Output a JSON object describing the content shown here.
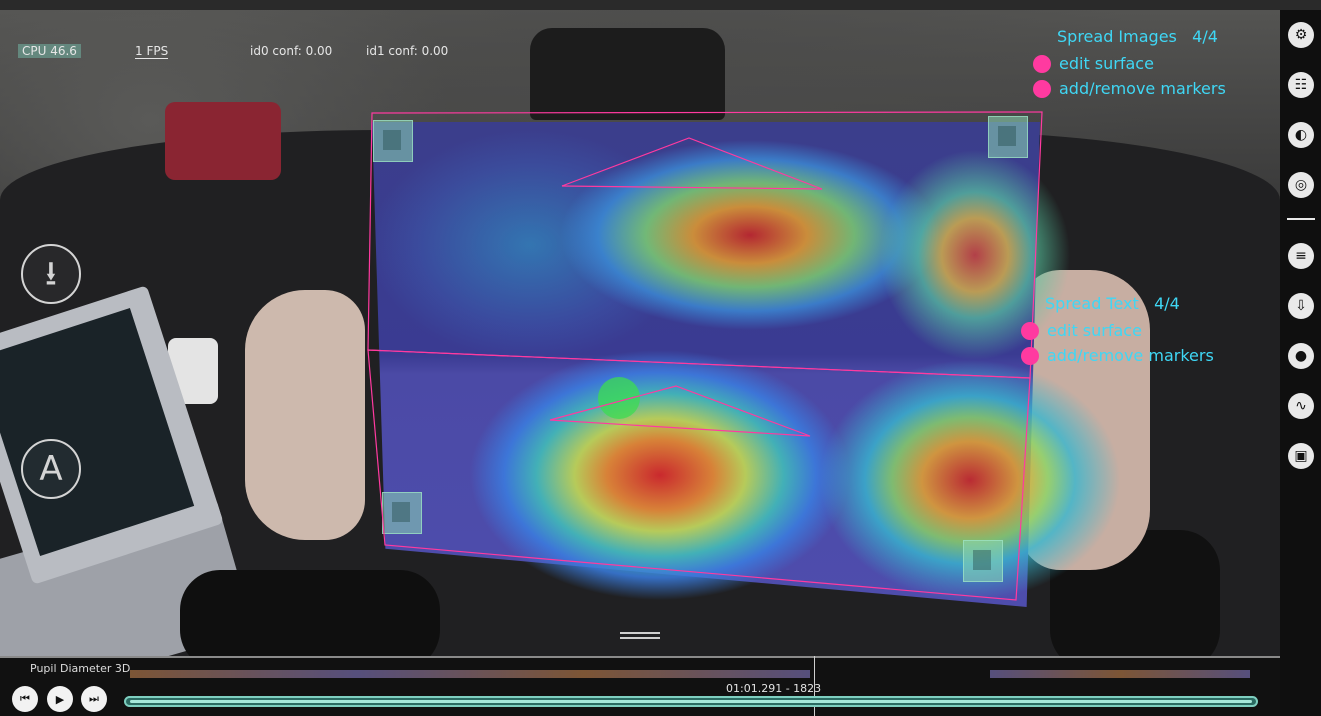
{
  "hud": {
    "cpu": "CPU 46.6",
    "fps": "1 FPS",
    "id0_conf": "id0 conf: 0.00",
    "id1_conf": "id1 conf: 0.00"
  },
  "left_buttons": {
    "download_icon": "⭳",
    "annotation_label": "A"
  },
  "surfaces": [
    {
      "title": "Spread Images",
      "count": "4/4",
      "actions": [
        "edit surface",
        "add/remove markers"
      ]
    },
    {
      "title": "Spread Text",
      "count": "4/4",
      "actions": [
        "edit surface",
        "add/remove markers"
      ]
    }
  ],
  "timeline": {
    "label": "Pupil Diameter 3D",
    "timestamp": "01:01.291 - 1823",
    "controls": [
      "skip-back-icon",
      "play-icon",
      "skip-forward-icon"
    ]
  },
  "iconbar": {
    "icons": [
      "settings-icon",
      "plugin-manager-icon",
      "eye-icon",
      "pupil-icon",
      "document-icon",
      "export-icon",
      "record-icon",
      "chart-line-icon",
      "surface-tracker-icon"
    ]
  },
  "colors": {
    "surface_label": "#3fd7f5",
    "toggle_dot": "#ff3aa0",
    "surface_outline": "#ff3aa0",
    "track": "#7ecfc0"
  }
}
